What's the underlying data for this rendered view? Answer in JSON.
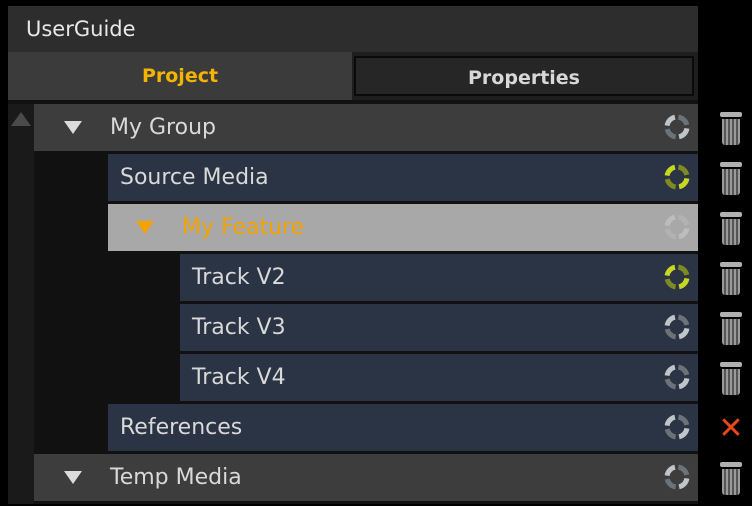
{
  "window": {
    "title": "UserGuide"
  },
  "tabs": [
    {
      "label": "Project"
    },
    {
      "label": "Properties"
    }
  ],
  "tree": {
    "items": [
      {
        "label": "My Group",
        "status": "idle"
      },
      {
        "label": "Source Media",
        "status": "active"
      },
      {
        "label": "My Feature",
        "status": "faded"
      },
      {
        "label": "Track V2",
        "status": "active"
      },
      {
        "label": "Track V3",
        "status": "idle"
      },
      {
        "label": "Track V4",
        "status": "idle"
      },
      {
        "label": "References",
        "status": "idle"
      },
      {
        "label": "Temp Media",
        "status": "idle"
      }
    ]
  },
  "colors": {
    "accent": "#f4a300",
    "status_active": "#c8d820",
    "status_idle": "#bfc5c9",
    "remove": "#e84a1a"
  },
  "icons": [
    "expand-arrow-icon",
    "sync-status-icon",
    "trash-icon",
    "remove-icon",
    "scroll-up-icon"
  ]
}
